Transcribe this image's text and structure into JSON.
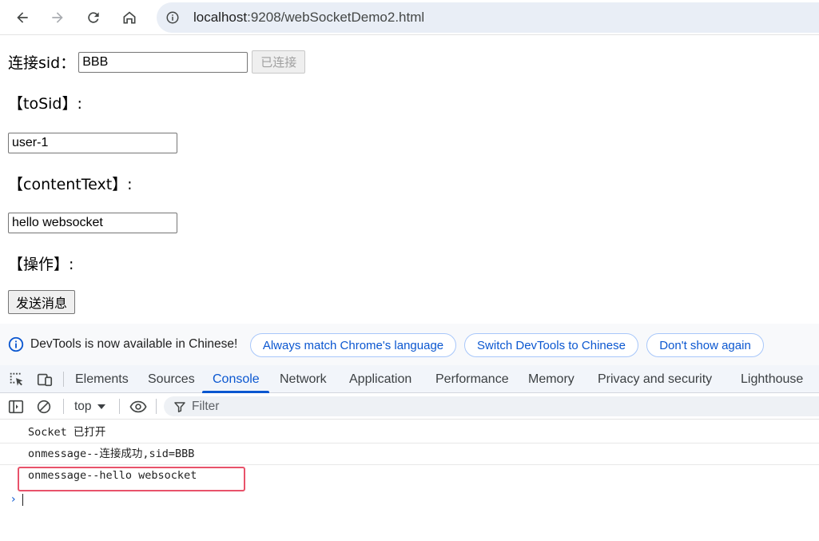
{
  "browser": {
    "url_host": "localhost",
    "url_rest": ":9208/webSocketDemo2.html"
  },
  "page": {
    "sid_label": "连接sid：",
    "sid_value": "BBB",
    "connect_button": "已连接",
    "tosid_label": "【toSid】:",
    "tosid_value": "user-1",
    "content_label": "【contentText】:",
    "content_value": "hello websocket",
    "action_label": "【操作】:",
    "send_button": "发送消息"
  },
  "devtools": {
    "infobar": {
      "message": "DevTools is now available in Chinese!",
      "always_match": "Always match Chrome's language",
      "switch_chinese": "Switch DevTools to Chinese",
      "dont_show": "Don't show again"
    },
    "tabs": [
      "Elements",
      "Sources",
      "Console",
      "Network",
      "Application",
      "Performance",
      "Memory",
      "Privacy and security",
      "Lighthouse"
    ],
    "active_tab": "Console",
    "console_toolbar": {
      "context": "top",
      "filter_placeholder": "Filter"
    },
    "messages": [
      "Socket 已打开",
      "onmessage--连接成功,sid=BBB",
      "onmessage--hello websocket"
    ],
    "highlight_color": "#e8526a",
    "accent_color": "#0b57d0"
  }
}
